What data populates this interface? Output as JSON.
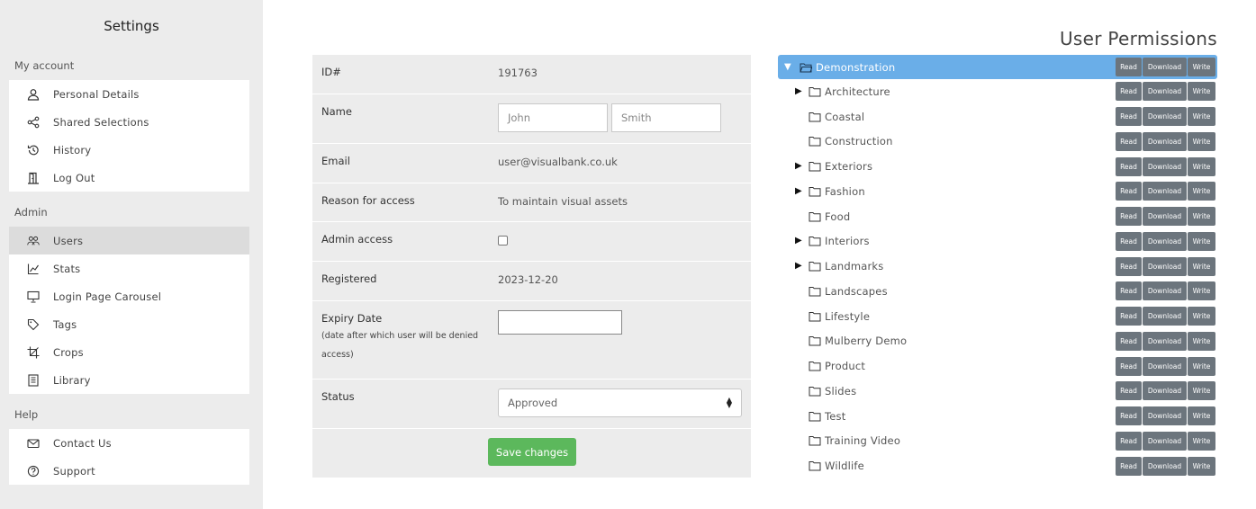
{
  "sidebar": {
    "title": "Settings",
    "sections": [
      {
        "heading": "My account",
        "items": [
          {
            "label": "Personal Details",
            "icon": "user-icon"
          },
          {
            "label": "Shared Selections",
            "icon": "share-icon"
          },
          {
            "label": "History",
            "icon": "history-icon"
          },
          {
            "label": "Log Out",
            "icon": "door-icon"
          }
        ]
      },
      {
        "heading": "Admin",
        "items": [
          {
            "label": "Users",
            "icon": "users-icon",
            "active": true
          },
          {
            "label": "Stats",
            "icon": "chart-icon"
          },
          {
            "label": "Login Page Carousel",
            "icon": "presentation-icon"
          },
          {
            "label": "Tags",
            "icon": "tag-icon"
          },
          {
            "label": "Crops",
            "icon": "crop-icon"
          },
          {
            "label": "Library",
            "icon": "library-icon"
          }
        ]
      },
      {
        "heading": "Help",
        "items": [
          {
            "label": "Contact Us",
            "icon": "envelope-icon"
          },
          {
            "label": "Support",
            "icon": "question-icon"
          }
        ]
      }
    ]
  },
  "form": {
    "id_label": "ID#",
    "id_value": "191763",
    "name_label": "Name",
    "first_name": "John",
    "last_name": "Smith",
    "email_label": "Email",
    "email_value": "user@visualbank.co.uk",
    "reason_label": "Reason for access",
    "reason_value": "To maintain visual assets",
    "admin_label": "Admin access",
    "admin_checked": false,
    "registered_label": "Registered",
    "registered_value": "2023-12-20",
    "expiry_label": "Expiry Date",
    "expiry_note": "(date after which user will be denied access)",
    "expiry_value": "",
    "status_label": "Status",
    "status_value": "Approved",
    "save_label": "Save changes"
  },
  "permissions": {
    "title": "User Permissions",
    "buttons": {
      "read": "Read",
      "download": "Download",
      "write": "Write"
    },
    "root": {
      "name": "Demonstration",
      "expanded": true
    },
    "folders": [
      {
        "name": "Architecture",
        "has_children": true
      },
      {
        "name": "Coastal",
        "has_children": false
      },
      {
        "name": "Construction",
        "has_children": false
      },
      {
        "name": "Exteriors",
        "has_children": true
      },
      {
        "name": "Fashion",
        "has_children": true
      },
      {
        "name": "Food",
        "has_children": false
      },
      {
        "name": "Interiors",
        "has_children": true
      },
      {
        "name": "Landmarks",
        "has_children": true
      },
      {
        "name": "Landscapes",
        "has_children": false
      },
      {
        "name": "Lifestyle",
        "has_children": false
      },
      {
        "name": "Mulberry Demo",
        "has_children": false
      },
      {
        "name": "Product",
        "has_children": false
      },
      {
        "name": "Slides",
        "has_children": false
      },
      {
        "name": "Test",
        "has_children": false
      },
      {
        "name": "Training Video",
        "has_children": false
      },
      {
        "name": "Wildlife",
        "has_children": false
      }
    ]
  },
  "colors": {
    "sidebar_bg": "#ececec",
    "active_item": "#dcdcdc",
    "tree_selected": "#6aaee8",
    "perm_button": "#6c757d",
    "save_button": "#5cb85c"
  }
}
